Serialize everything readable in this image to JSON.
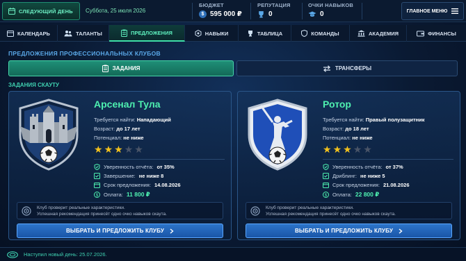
{
  "topbar": {
    "next_day_label": "СЛЕДУЮЩИЙ ДЕНЬ",
    "date": "Суббота, 25 июля 2026",
    "budget_caption": "БЮДЖЕТ",
    "budget_value": "595 000 ₽",
    "reputation_caption": "РЕПУТАЦИЯ",
    "reputation_value": "0",
    "skill_points_caption": "ОЧКИ НАВЫКОВ",
    "skill_points_value": "0",
    "main_menu_label": "ГЛАВНОЕ МЕНЮ"
  },
  "tabs": [
    {
      "label": "КАЛЕНДАРЬ",
      "icon": "calendar-icon"
    },
    {
      "label": "ТАЛАНТЫ",
      "icon": "users-icon"
    },
    {
      "label": "ПРЕДЛОЖЕНИЯ",
      "icon": "clipboard-icon",
      "active": true
    },
    {
      "label": "НАВЫКИ",
      "icon": "hexagon-icon"
    },
    {
      "label": "ТАБЛИЦА",
      "icon": "trophy-icon"
    },
    {
      "label": "КОМАНДЫ",
      "icon": "shield-icon"
    },
    {
      "label": "АКАДЕМИЯ",
      "icon": "building-icon"
    },
    {
      "label": "ФИНАНСЫ",
      "icon": "wallet-icon"
    }
  ],
  "offers": {
    "section_title": "ПРЕДЛОЖЕНИЯ ПРОФЕССИОНАЛЬНЫХ КЛУБОВ",
    "segment_tasks": "ЗАДАНИЯ",
    "segment_transfers": "ТРАНСФЕРЫ",
    "subtitle": "ЗАДАНИЯ СКАУТУ",
    "cards": [
      {
        "club": "Арсенал Тула",
        "find_label": "Требуется найти:",
        "find_value": "Нападающий",
        "age_label": "Возраст:",
        "age_value": "до 17 лет",
        "potential_label": "Потенциал:",
        "potential_value": "не ниже",
        "stars": 3,
        "stars_max": 5,
        "criteria": [
          {
            "label": "Уверенность отчёта:",
            "value": "от 35%"
          },
          {
            "label": "Завершение:",
            "value": "не ниже 8"
          },
          {
            "label": "Срок предложения:",
            "value": "14.08.2026"
          }
        ],
        "payment_label": "Оплата:",
        "payment_value": "11 800 ₽",
        "note_line1": "Клуб проверит реальные характеристики.",
        "note_line2": "Успешная рекомендация принесёт одно очко навыков скаута.",
        "cta_label": "ВЫБРАТЬ И ПРЕДЛОЖИТЬ КЛУБУ"
      },
      {
        "club": "Ротор",
        "find_label": "Требуется найти:",
        "find_value": "Правый полузащитник",
        "age_label": "Возраст:",
        "age_value": "до 18 лет",
        "potential_label": "Потенциал:",
        "potential_value": "не ниже",
        "stars": 3,
        "stars_max": 5,
        "criteria": [
          {
            "label": "Уверенность отчёта:",
            "value": "от 37%"
          },
          {
            "label": "Дриблинг:",
            "value": "не ниже 5"
          },
          {
            "label": "Срок предложения:",
            "value": "21.08.2026"
          }
        ],
        "payment_label": "Оплата:",
        "payment_value": "22 800 ₽",
        "note_line1": "Клуб проверит реальные характеристики.",
        "note_line2": "Успешная рекомендация принесёт одно очко навыков скаута.",
        "cta_label": "ВЫБРАТЬ И ПРЕДЛОЖИТЬ КЛУБУ"
      }
    ]
  },
  "footer": {
    "message": "Наступил новый день: 25.07.2026."
  },
  "colors": {
    "accent_green": "#4ef0b0",
    "accent_blue": "#2d74c9",
    "star_on": "#f3c21d"
  }
}
